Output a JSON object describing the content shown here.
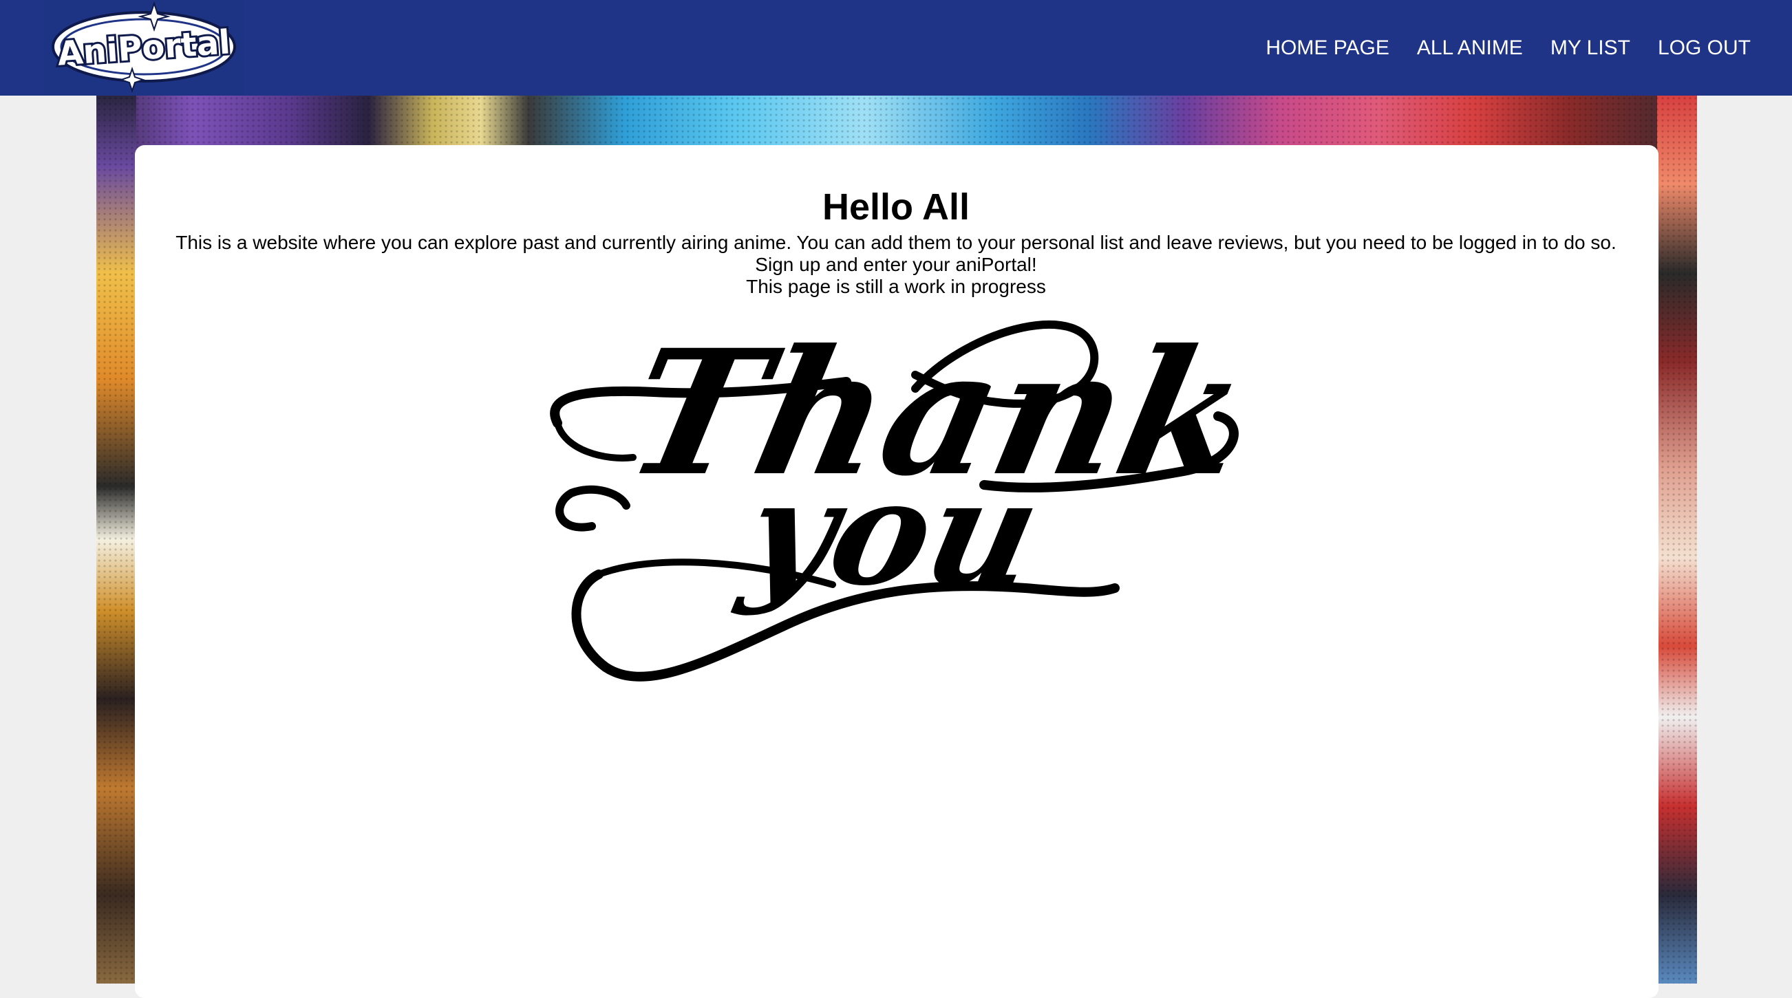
{
  "brand": {
    "logo_text": "AniPortal"
  },
  "nav": {
    "items": [
      {
        "label": "HOME PAGE"
      },
      {
        "label": "ALL ANIME"
      },
      {
        "label": "MY LIST"
      },
      {
        "label": "LOG OUT"
      }
    ]
  },
  "main": {
    "heading": "Hello All",
    "lines": [
      "This is a website where you can explore past and currently airing anime. You can add them to your personal list and leave reviews, but you need to be logged in to do so.",
      "Sign up and enter your aniPortal!",
      "This page is still a work in progress"
    ],
    "thank_image": {
      "line1": "Thank",
      "line2": "you"
    }
  }
}
